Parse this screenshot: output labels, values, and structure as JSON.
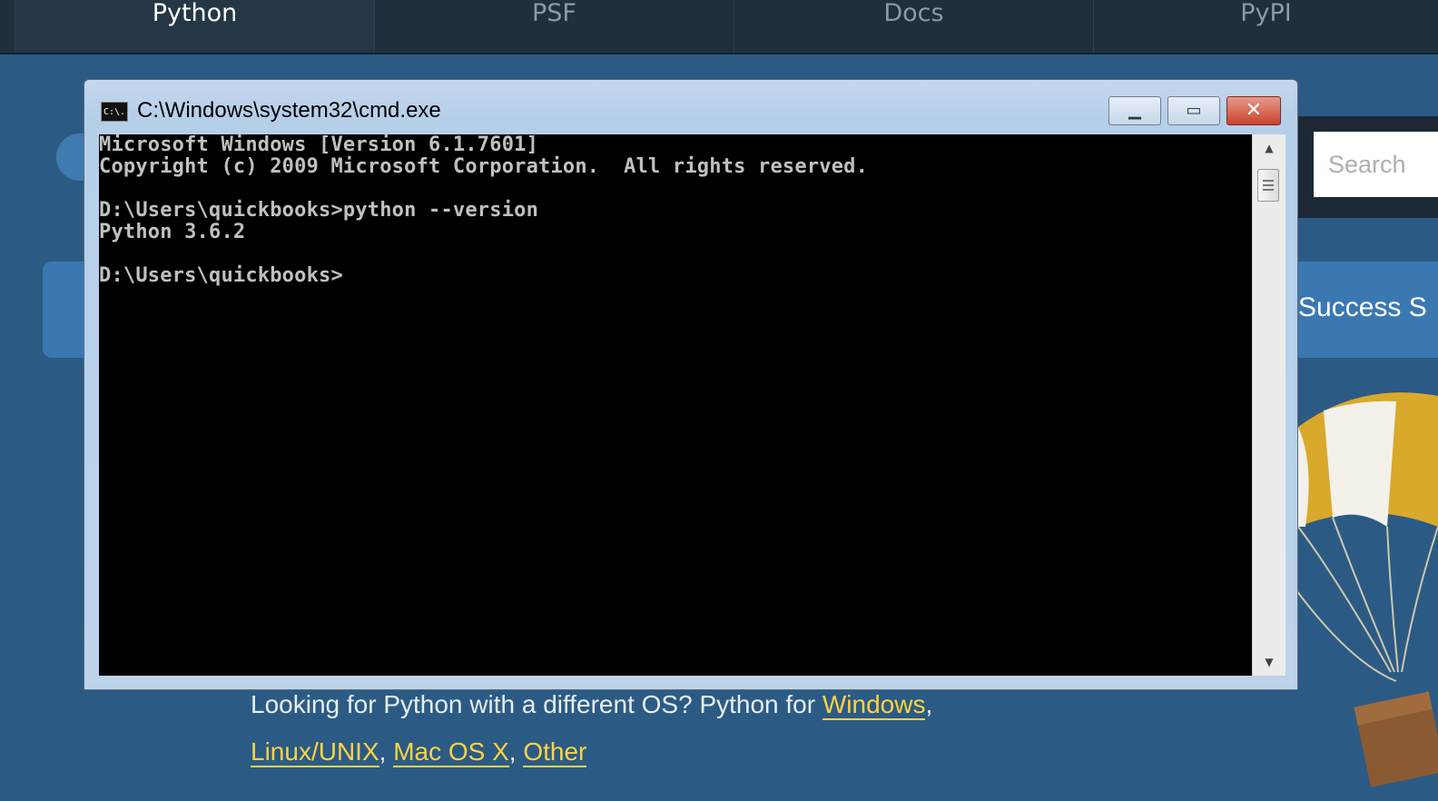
{
  "nav": {
    "tabs": [
      {
        "label": "Python",
        "active": true
      },
      {
        "label": "PSF",
        "active": false
      },
      {
        "label": "Docs",
        "active": false
      },
      {
        "label": "PyPI",
        "active": false
      }
    ]
  },
  "search": {
    "placeholder": "Search"
  },
  "banner": {
    "success_text": "Success S"
  },
  "os_links": {
    "prefix": "Looking for Python with a different OS? Python for ",
    "windows": "Windows",
    "comma": ",",
    "linux": "Linux/UNIX",
    "mac": "Mac OS X",
    "other": "Other"
  },
  "cmd": {
    "title": "C:\\Windows\\system32\\cmd.exe",
    "icon_text": "C:\\.",
    "lines": [
      "Microsoft Windows [Version 6.1.7601]",
      "Copyright (c) 2009 Microsoft Corporation.  All rights reserved.",
      "",
      "D:\\Users\\quickbooks>python --version",
      "Python 3.6.2",
      "",
      "D:\\Users\\quickbooks>"
    ],
    "buttons": {
      "minimize": "▁",
      "maximize": "▭",
      "close": "✕"
    }
  },
  "colors": {
    "page_bg": "#2b5b84",
    "nav_bg": "#1e2f3e",
    "link": "#ffd343",
    "console_bg": "#000000",
    "console_text": "#c0c0c0"
  }
}
